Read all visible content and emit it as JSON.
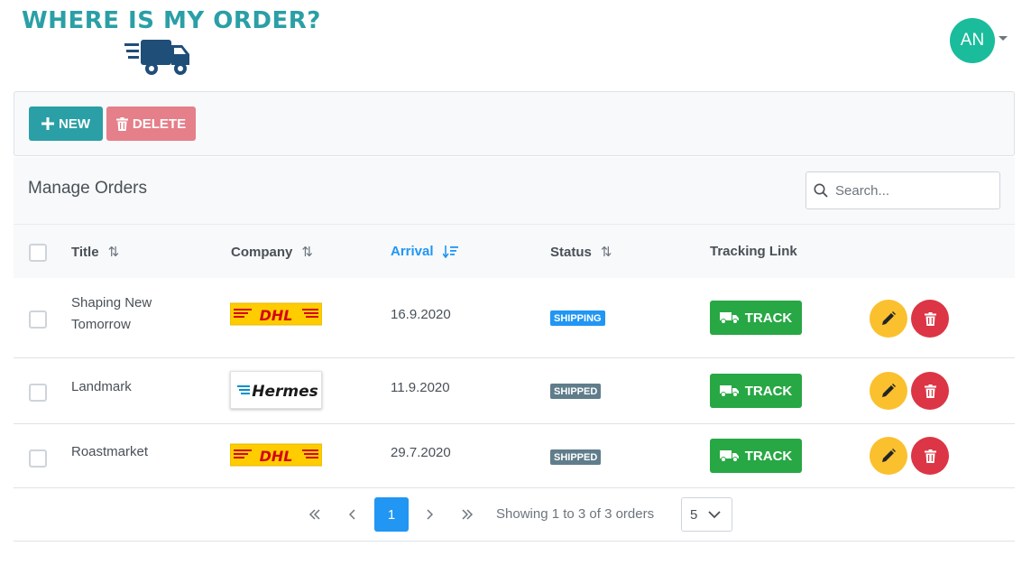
{
  "app": {
    "logo_text": "WHERE IS MY ORDER?",
    "user_initials": "AN"
  },
  "toolbar": {
    "new_label": "NEW",
    "delete_label": "DELETE"
  },
  "table": {
    "title": "Manage Orders",
    "search_placeholder": "Search...",
    "columns": {
      "title": "Title",
      "company": "Company",
      "arrival": "Arrival",
      "status": "Status",
      "tracking": "Tracking Link"
    },
    "rows": [
      {
        "title": "Shaping New Tomorrow",
        "company": "DHL",
        "arrival": "16.9.2020",
        "status": "SHIPPING",
        "track_label": "TRACK"
      },
      {
        "title": "Landmark",
        "company": "Hermes",
        "arrival": "11.9.2020",
        "status": "SHIPPED",
        "track_label": "TRACK"
      },
      {
        "title": "Roastmarket",
        "company": "DHL",
        "arrival": "29.7.2020",
        "status": "SHIPPED",
        "track_label": "TRACK"
      }
    ]
  },
  "paginator": {
    "current_page": "1",
    "report": "Showing 1 to 3 of 3 orders",
    "rows_per_page": "5"
  },
  "colors": {
    "brand": "#2a9fa6",
    "avatar": "#1abc9c",
    "shipping": "#2196f3",
    "shipped": "#607d8b",
    "track": "#28a745",
    "edit": "#fbc02d",
    "delete": "#dc3545",
    "dhl_yellow": "#ffcc00",
    "dhl_red": "#d40511"
  },
  "icons": {
    "logo": "delivery-truck-icon",
    "new": "plus-icon",
    "delete": "trash-icon",
    "search": "search-icon",
    "sort": "sort-icon",
    "track": "truck-icon",
    "edit": "pencil-icon",
    "row_delete": "trash-icon",
    "first": "double-chevron-left-icon",
    "prev": "chevron-left-icon",
    "next": "chevron-right-icon",
    "last": "double-chevron-right-icon",
    "dropdown": "chevron-down-icon"
  }
}
